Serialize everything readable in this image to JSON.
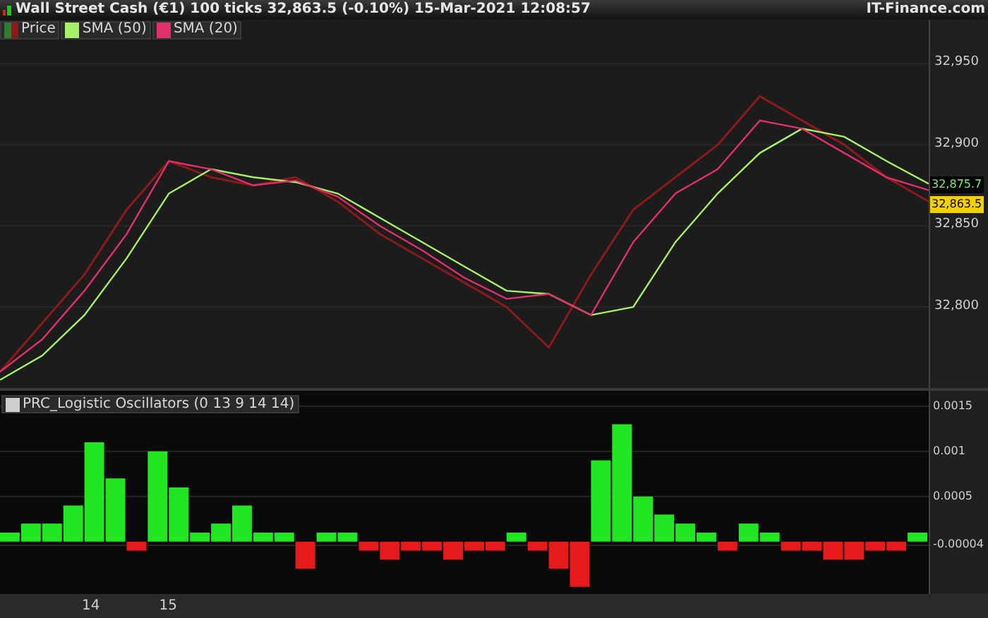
{
  "title_bar": {
    "title": "Wall Street Cash (€1) 100 ticks 32,863.5 (-0.10%) 15-Mar-2021 12:08:57",
    "brand": "IT-Finance.com"
  },
  "price_pane": {
    "price_markers": [
      {
        "text": "32,875.7",
        "kind": "sma"
      },
      {
        "text": "32,863.5",
        "kind": "last"
      }
    ],
    "chart_data": {
      "type": "line",
      "ylim": [
        32750,
        32965
      ],
      "grid": true,
      "legend": "top-left",
      "yticks": [
        {
          "value": 32800,
          "label": "32,800"
        },
        {
          "value": 32850,
          "label": "32,850"
        },
        {
          "value": 32900,
          "label": "32,900"
        },
        {
          "value": 32950,
          "label": "32,950"
        }
      ],
      "series": [
        {
          "name": "Price",
          "color": "#8b1a1a",
          "values": [
            32760,
            32790,
            32820,
            32860,
            32890,
            32880,
            32875,
            32880,
            32865,
            32845,
            32830,
            32815,
            32800,
            32775,
            32820,
            32860,
            32880,
            32900,
            32930,
            32915,
            32900,
            32880,
            32865
          ]
        },
        {
          "name": "SMA (50)",
          "color": "#a6f06a",
          "values": [
            32755,
            32770,
            32795,
            32830,
            32870,
            32885,
            32880,
            32877,
            32870,
            32855,
            32840,
            32825,
            32810,
            32808,
            32795,
            32800,
            32840,
            32870,
            32895,
            32910,
            32905,
            32890,
            32876
          ]
        },
        {
          "name": "SMA (20)",
          "color": "#e0306a",
          "values": [
            32760,
            32780,
            32810,
            32845,
            32890,
            32885,
            32875,
            32878,
            32868,
            32850,
            32835,
            32818,
            32805,
            32808,
            32795,
            32840,
            32870,
            32885,
            32915,
            32910,
            32895,
            32880,
            32872
          ]
        }
      ]
    }
  },
  "oscillator_pane": {
    "legend": {
      "label": "PRC_Logistic Oscillators (0 13 9 14 14)"
    },
    "chart_data": {
      "type": "bar",
      "ylim": [
        -0.00058,
        0.00167
      ],
      "grid": true,
      "yticks": [
        {
          "value": -4e-05,
          "label": "-0.00004"
        },
        {
          "value": 0.0005,
          "label": "0.0005"
        },
        {
          "value": 0.001,
          "label": "0.001"
        },
        {
          "value": 0.0015,
          "label": "0.0015"
        }
      ],
      "values": [
        0.0001,
        0.0002,
        0.0002,
        0.0004,
        0.0011,
        0.0007,
        -0.0001,
        0.001,
        0.0006,
        0.0001,
        0.0002,
        0.0004,
        0.0001,
        0.0001,
        -0.0003,
        0.0001,
        0.0001,
        -0.0001,
        -0.0002,
        -0.0001,
        -0.0001,
        -0.0002,
        -0.0001,
        -0.0001,
        0.0001,
        -0.0001,
        -0.0003,
        -0.0005,
        0.0009,
        0.0013,
        0.0005,
        0.0003,
        0.0002,
        0.0001,
        -0.0001,
        0.0002,
        0.0001,
        -0.0001,
        -0.0001,
        -0.0002,
        -0.0002,
        -0.0001,
        -0.0001,
        0.0001
      ]
    }
  },
  "x_axis": {
    "labels": [
      "14",
      "15"
    ]
  }
}
